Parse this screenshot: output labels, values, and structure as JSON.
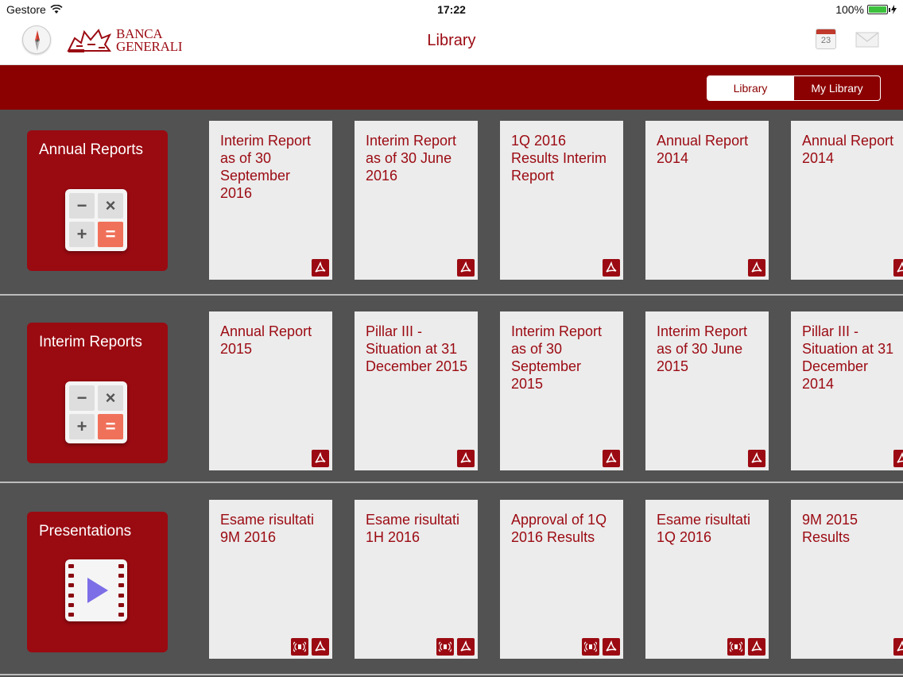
{
  "status_bar": {
    "carrier": "Gestore",
    "time": "17:22",
    "battery": "100%"
  },
  "nav": {
    "title": "Library",
    "logo": {
      "line1": "BANCA",
      "line2": "GENERALI"
    },
    "calendar_day": "23",
    "icons": [
      "compass-icon",
      "calendar-icon",
      "mail-icon"
    ]
  },
  "segmented": {
    "library_label": "Library",
    "my_library_label": "My Library",
    "selected": "Library"
  },
  "colors": {
    "brand_red": "#9b0a12",
    "header_band": "#8b0000",
    "background": "#525252",
    "card": "#ececec"
  },
  "shelves": [
    {
      "category": "Annual Reports",
      "category_icon": "calculator-icon",
      "documents": [
        {
          "title": "Interim Report as of 30 September 2016",
          "has_audio": false
        },
        {
          "title": "Interim Report as of 30 June 2016",
          "has_audio": false
        },
        {
          "title": "1Q 2016 Results Interim Report",
          "has_audio": false
        },
        {
          "title": "Annual Report 2014",
          "has_audio": false
        },
        {
          "title": "Annual Report 2014",
          "has_audio": false
        }
      ]
    },
    {
      "category": "Interim Reports",
      "category_icon": "calculator-icon",
      "documents": [
        {
          "title": "Annual Report 2015",
          "has_audio": false
        },
        {
          "title": "Pillar III - Situation at 31 December 2015",
          "has_audio": false
        },
        {
          "title": "Interim Report as of 30 September 2015",
          "has_audio": false
        },
        {
          "title": "Interim Report as of 30 June 2015",
          "has_audio": false
        },
        {
          "title": "Pillar III - Situation at 31 December 2014",
          "has_audio": false
        }
      ]
    },
    {
      "category": "Presentations",
      "category_icon": "video-icon",
      "documents": [
        {
          "title": "Esame risultati 9M 2016",
          "has_audio": true
        },
        {
          "title": "Esame risultati 1H 2016",
          "has_audio": true
        },
        {
          "title": "Approval of 1Q 2016 Results",
          "has_audio": true
        },
        {
          "title": "Esame risultati 1Q 2016",
          "has_audio": true
        },
        {
          "title": "9M 2015 Results",
          "has_audio": true
        }
      ]
    }
  ]
}
